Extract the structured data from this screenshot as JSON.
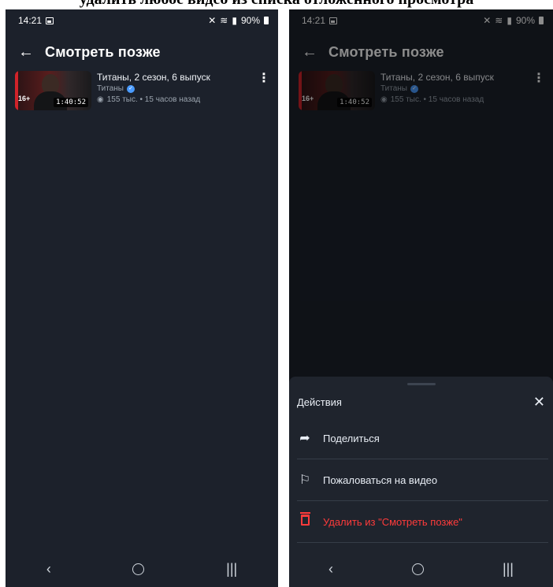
{
  "caption": "удалить любое видео из списка отложенного просмотра",
  "status": {
    "time": "14:21",
    "battery": "90%"
  },
  "appbar": {
    "title": "Смотреть позже"
  },
  "video": {
    "title": "Титаны, 2 сезон, 6 выпуск",
    "channel": "Титаны",
    "stats": "155 тыс. • 15 часов назад",
    "duration": "1:40:52",
    "age_badge": "16+"
  },
  "sheet": {
    "title": "Действия",
    "actions": [
      {
        "label": "Поделиться",
        "icon": "share-icon"
      },
      {
        "label": "Пожаловаться на видео",
        "icon": "flag-icon"
      },
      {
        "label": "Удалить из \"Смотреть позже\"",
        "icon": "trash-icon"
      }
    ]
  },
  "colors": {
    "background": "#1c212b",
    "danger": "#ff3b3b",
    "verified": "#4a9bff"
  },
  "icons": [
    "back-arrow-icon",
    "more-vert-icon",
    "eye-icon",
    "verified-icon",
    "close-icon",
    "nav-back-icon",
    "nav-home-icon",
    "nav-recents-icon"
  ]
}
